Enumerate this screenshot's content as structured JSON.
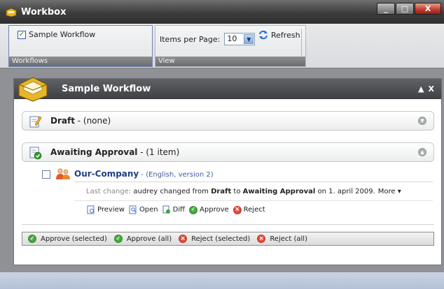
{
  "app": {
    "title": "Workbox"
  },
  "window_controls": {
    "minimize": "_",
    "maximize": "□",
    "close": "X"
  },
  "ribbon": {
    "workflows_group": {
      "label": "Workflows",
      "checkbox_label": "Sample Workflow",
      "checked": true
    },
    "view_group": {
      "label": "View",
      "items_per_page_label": "Items per Page:",
      "items_per_page_value": "10",
      "refresh_label": "Refresh"
    }
  },
  "panel": {
    "title": "Sample Workflow",
    "collapse_icon": "▲",
    "close_icon": "X",
    "sections": {
      "draft": {
        "label": "Draft",
        "detail": " - (none)"
      },
      "awaiting": {
        "label": "Awaiting Approval",
        "detail": " - (1 item)"
      }
    },
    "item": {
      "name": "Our-Company",
      "meta": " - (English, version 2)",
      "last_change_prefix": "Last change:",
      "last_change_text": " audrey changed from ",
      "from_state": "Draft",
      "to_word": " to ",
      "to_state": "Awaiting Approval",
      "date_text": " on 1. april 2009.",
      "more_label": "More ▾",
      "actions": {
        "preview": "Preview",
        "open": "Open",
        "diff": "Diff",
        "approve": "Approve",
        "reject": "Reject"
      }
    },
    "bulk_actions": {
      "approve_selected": "Approve (selected)",
      "approve_all": "Approve (all)",
      "reject_selected": "Reject (selected)",
      "reject_all": "Reject (all)"
    }
  },
  "colors": {
    "title_bar": "#3c3c3c",
    "link_blue": "#1f3f86",
    "approve_green": "#1f7d1a",
    "reject_red": "#b8221a"
  }
}
